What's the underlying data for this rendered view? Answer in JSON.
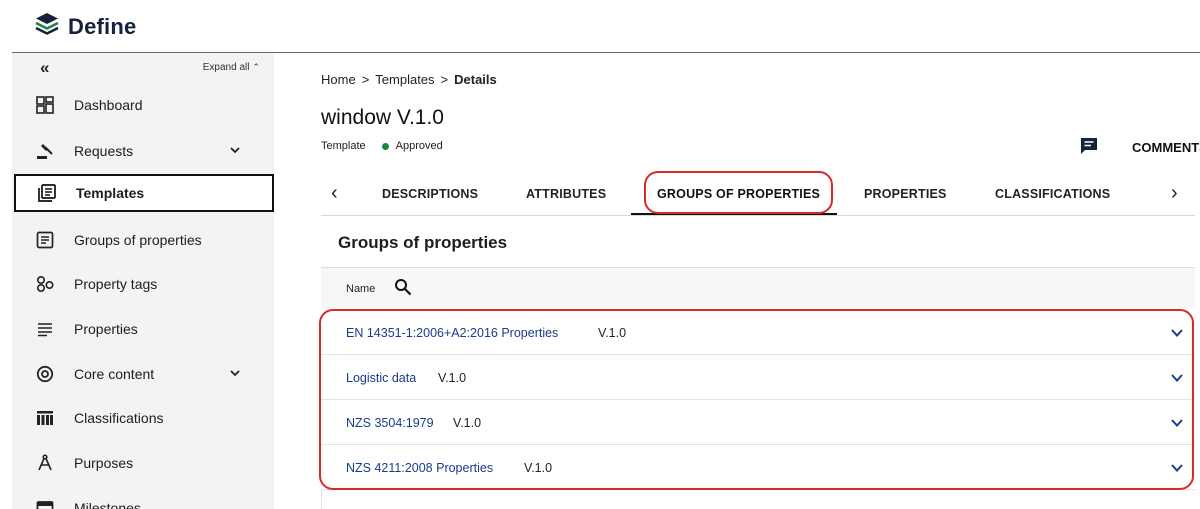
{
  "app": {
    "name": "Define",
    "brand_color": "#14223d",
    "accent_red": "#d92a2a"
  },
  "sidebar": {
    "collapse_label": "«",
    "expand_all": "Expand all",
    "items": [
      {
        "label": "Dashboard",
        "icon": "dashboard-icon"
      },
      {
        "label": "Requests",
        "icon": "gavel-icon",
        "has_submenu": true
      },
      {
        "label": "Templates",
        "icon": "templates-icon",
        "active": true
      },
      {
        "label": "Groups of properties",
        "icon": "list-box-icon"
      },
      {
        "label": "Property tags",
        "icon": "tags-icon"
      },
      {
        "label": "Properties",
        "icon": "lines-icon"
      },
      {
        "label": "Core content",
        "icon": "at-target-icon",
        "has_submenu": true
      },
      {
        "label": "Classifications",
        "icon": "classification-icon"
      },
      {
        "label": "Purposes",
        "icon": "compass-icon"
      },
      {
        "label": "Milestones",
        "icon": "calendar-icon"
      }
    ]
  },
  "breadcrumb": {
    "home": "Home",
    "templates": "Templates",
    "details": "Details",
    "separator": ">"
  },
  "page": {
    "title": "window V.1.0",
    "type": "Template",
    "status": "Approved",
    "status_color": "#1a8a3a",
    "comments_label": "COMMENTS"
  },
  "tabs": {
    "items": [
      "DESCRIPTIONS",
      "ATTRIBUTES",
      "GROUPS OF PROPERTIES",
      "PROPERTIES",
      "CLASSIFICATIONS"
    ],
    "active": "GROUPS OF PROPERTIES"
  },
  "panel": {
    "title": "Groups of properties",
    "column_name": "Name",
    "groups": [
      {
        "name": "EN 14351-1:2006+A2:2016 Properties",
        "version": "V.1.0"
      },
      {
        "name": "Logistic data",
        "version": "V.1.0"
      },
      {
        "name": "NZS 3504:1979",
        "version": "V.1.0"
      },
      {
        "name": "NZS 4211:2008 Properties",
        "version": "V.1.0"
      }
    ]
  }
}
